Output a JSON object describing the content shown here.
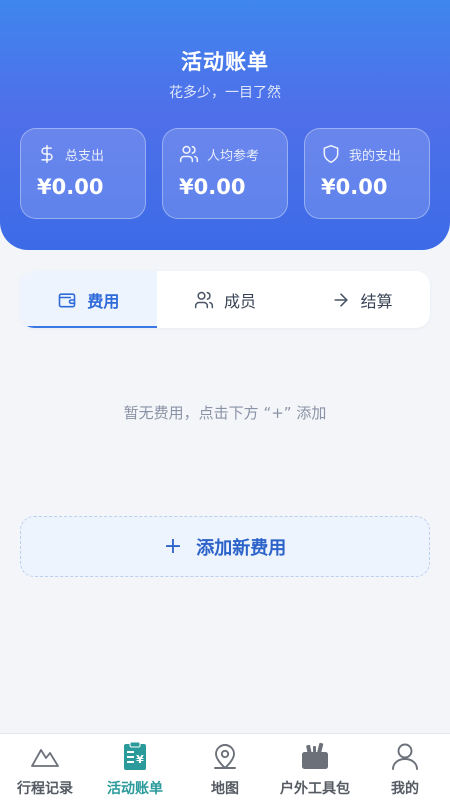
{
  "header": {
    "title": "活动账单",
    "subtitle": "花多少，一目了然"
  },
  "stats": [
    {
      "label": "总支出",
      "value": "¥0.00",
      "icon": "dollar-icon"
    },
    {
      "label": "人均参考",
      "value": "¥0.00",
      "icon": "users-icon"
    },
    {
      "label": "我的支出",
      "value": "¥0.00",
      "icon": "shield-icon"
    }
  ],
  "tabs": [
    {
      "label": "费用",
      "icon": "wallet-icon",
      "active": true
    },
    {
      "label": "成员",
      "icon": "users-icon",
      "active": false
    },
    {
      "label": "结算",
      "icon": "arrow-right-icon",
      "active": false
    }
  ],
  "empty_text": "暂无费用，点击下方 “+” 添加",
  "add_button": {
    "icon": "plus",
    "label": "添加新费用"
  },
  "bottom_nav": [
    {
      "label": "行程记录",
      "icon": "mountain-icon",
      "active": false
    },
    {
      "label": "活动账单",
      "icon": "bill-icon",
      "active": true
    },
    {
      "label": "地图",
      "icon": "map-pin-icon",
      "active": false
    },
    {
      "label": "户外工具包",
      "icon": "toolbox-icon",
      "active": false
    },
    {
      "label": "我的",
      "icon": "user-icon",
      "active": false
    }
  ],
  "colors": {
    "header_gradient_top": "#3f86ee",
    "header_gradient_bottom": "#3c6be8",
    "accent": "#2e6ad8",
    "nav_active": "#2a9a9a"
  }
}
